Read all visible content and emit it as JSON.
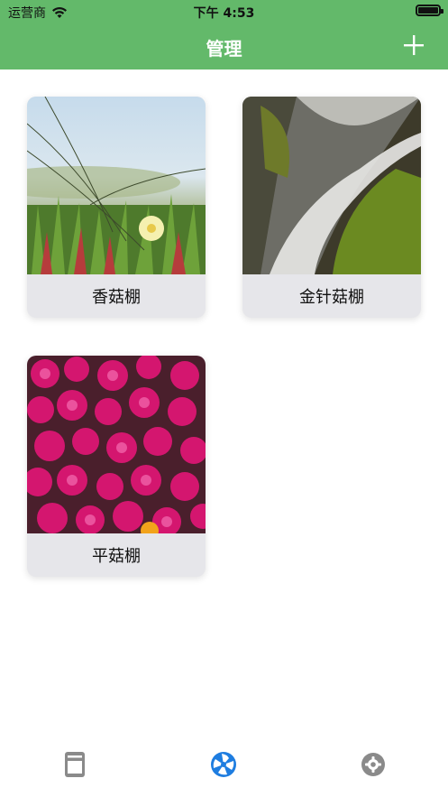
{
  "status_bar": {
    "carrier": "运营商",
    "time": "下午 4:53"
  },
  "header": {
    "title": "管理",
    "accent_color": "#63b96a"
  },
  "cards": [
    {
      "label": "香菇棚",
      "image": "ice-plant-grass-photo"
    },
    {
      "label": "金针菇棚",
      "image": "waterfall-photo"
    },
    {
      "label": "平菇棚",
      "image": "magenta-flowers-photo"
    }
  ],
  "tabbar": {
    "items": [
      {
        "icon": "document-icon",
        "active": false
      },
      {
        "icon": "aperture-icon",
        "active": true
      },
      {
        "icon": "gear-icon",
        "active": false
      }
    ],
    "active_color": "#1e7de0",
    "inactive_color": "#8a8a8a"
  }
}
